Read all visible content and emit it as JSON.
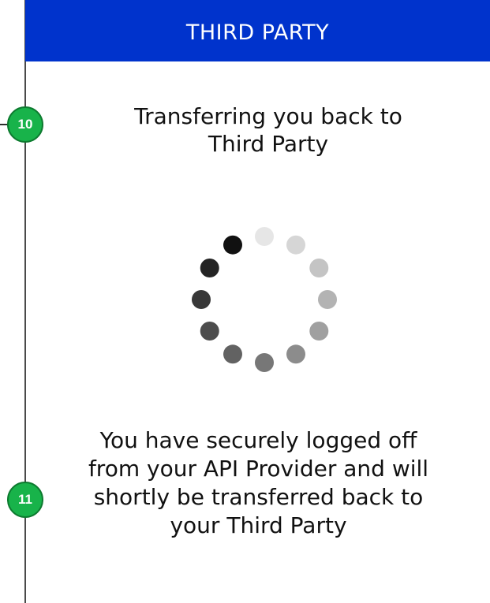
{
  "header": {
    "title": "THIRD PARTY",
    "background_color": "#0033cc"
  },
  "steps": [
    {
      "number": "10"
    },
    {
      "number": "11"
    }
  ],
  "step_badge_color": "#18b34a",
  "loading": {
    "heading": "Transferring you back to\nThird Party",
    "spinner_icon": "loading-spinner-icon",
    "message": "You have securely logged off from your API Provider and will shortly be transferred back to your Third Party"
  }
}
